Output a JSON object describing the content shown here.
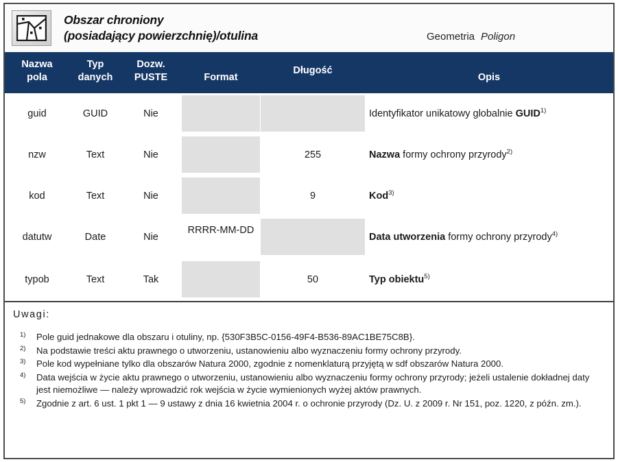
{
  "header": {
    "icon": "polygon-parcel-icon",
    "title_line1": "Obszar chroniony",
    "title_line2": "(posiadający powierzchnię)/otulina",
    "geometry_label": "Geometria",
    "geometry_value": "Poligon"
  },
  "colors": {
    "header_navy": "#153766",
    "empty_cell_grey": "#e0e0e0",
    "border": "#4a4a4a"
  },
  "table": {
    "columns": [
      "Nazwa pola",
      "Typ danych",
      "Dozw. PUSTE",
      "Format",
      "Długość",
      "Opis"
    ],
    "columns_split": {
      "nazwa_l1": "Nazwa",
      "nazwa_l2": "pola",
      "typ_l1": "Typ",
      "typ_l2": "danych",
      "dozw_l1": "Dozw.",
      "dozw_l2": "PUSTE",
      "format": "Format",
      "dlugosc": "Długość",
      "opis": "Opis"
    },
    "rows": [
      {
        "name": "guid",
        "type": "GUID",
        "nullable": "Nie",
        "format": "",
        "format_empty": true,
        "length": "",
        "length_empty": true,
        "desc_plain": "Identyfikator unikatowy globalnie ",
        "desc_bold": "GUID",
        "desc_sup": "1)",
        "desc_tail": "",
        "bold_first": false
      },
      {
        "name": "nzw",
        "type": "Text",
        "nullable": "Nie",
        "format": "",
        "format_empty": true,
        "length": "255",
        "length_empty": false,
        "desc_plain": "",
        "desc_bold": "Nazwa",
        "desc_sup": "2)",
        "desc_tail": " formy ochrony przyrody",
        "bold_first": true
      },
      {
        "name": "kod",
        "type": "Text",
        "nullable": "Nie",
        "format": "",
        "format_empty": true,
        "length": "9",
        "length_empty": false,
        "desc_plain": "",
        "desc_bold": "Kod",
        "desc_sup": "3)",
        "desc_tail": "",
        "bold_first": true
      },
      {
        "name": "datutw",
        "type": "Date",
        "nullable": "Nie",
        "format": "RRRR-MM-DD",
        "format_empty": false,
        "length": "",
        "length_empty": true,
        "desc_plain": "",
        "desc_bold": "Data utworzenia",
        "desc_sup": "4)",
        "desc_tail": " formy ochrony przyrody",
        "bold_first": true
      },
      {
        "name": "typob",
        "type": "Text",
        "nullable": "Tak",
        "format": "",
        "format_empty": true,
        "length": "50",
        "length_empty": false,
        "desc_plain": "",
        "desc_bold": "Typ obiektu",
        "desc_sup": "5)",
        "desc_tail": "",
        "bold_first": true
      }
    ]
  },
  "notes": {
    "title": "Uwagi:",
    "items": [
      {
        "marker": "1)",
        "text": "Pole guid jednakowe dla obszaru i otuliny, np. {530F3B5C-0156-49F4-B536-89AC1BE75C8B}."
      },
      {
        "marker": "2)",
        "text": "Na podstawie treści aktu prawnego o utworzeniu, ustanowieniu albo wyznaczeniu formy ochrony przyrody."
      },
      {
        "marker": "3)",
        "text": "Pole kod wypełniane tylko dla obszarów Natura 2000, zgodnie z nomenklaturą przyjętą w sdf obszarów Natura 2000."
      },
      {
        "marker": "4)",
        "text": "Data wejścia w życie aktu prawnego o utworzeniu, ustanowieniu albo wyznaczeniu formy ochrony przyrody; jeżeli ustalenie dokładnej daty jest niemożliwe  — należy wprowadzić rok wejścia w życie wymienionych wyżej aktów prawnych."
      },
      {
        "marker": "5)",
        "text": "Zgodnie z art. 6 ust. 1 pkt 1 — 9 ustawy z dnia 16 kwietnia 2004 r. o ochronie przyrody (Dz. U. z 2009 r. Nr 151, poz. 1220, z późn. zm.)."
      }
    ]
  }
}
